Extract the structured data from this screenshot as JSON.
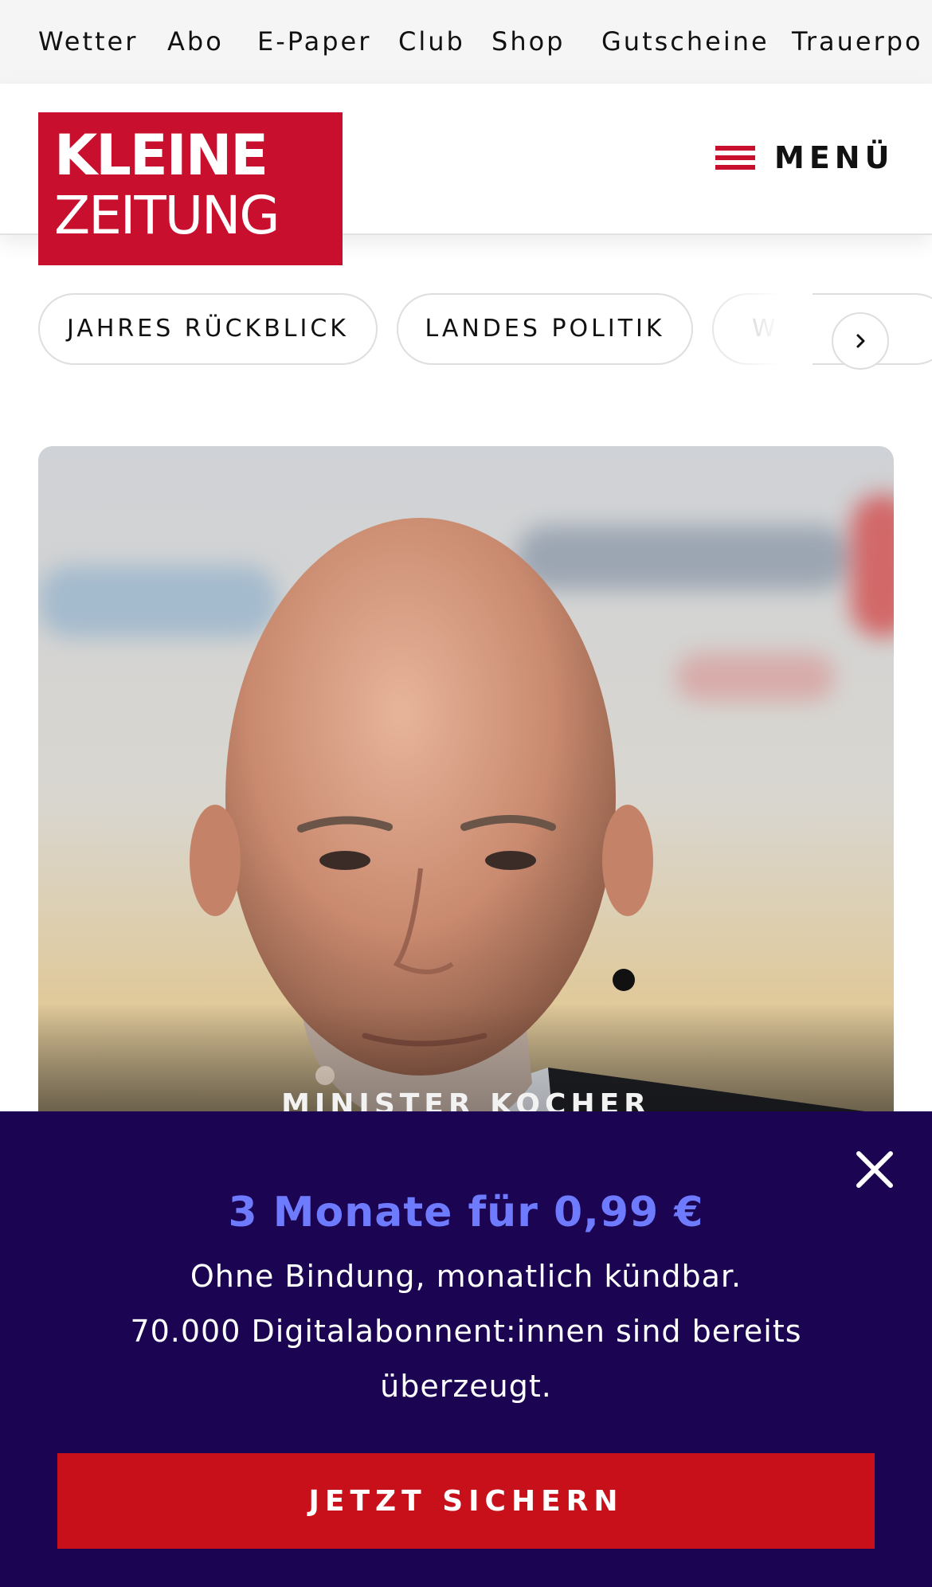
{
  "topbar": {
    "links": [
      "Wetter",
      "Abo",
      "E-Paper",
      "Club",
      "Shop",
      "Gutscheine",
      "Trauerpo"
    ]
  },
  "header": {
    "logo_line1": "KLEINE",
    "logo_line2": "ZEITUNG",
    "menu_label": "MENÜ",
    "accent_color": "#c8102e"
  },
  "chips": [
    "JAHRES RÜCKBLICK",
    "LANDES POLITIK",
    "WE"
  ],
  "hero": {
    "caption": "MINISTER KOCHER"
  },
  "promo": {
    "title": "3 Monate für 0,99 €",
    "line1": "Ohne Bindung, monatlich kündbar.",
    "line2": "70.000 Digitalabonnent:innen sind bereits",
    "line3": "überzeugt.",
    "cta": "JETZT SICHERN",
    "background_color": "#1b0552",
    "title_color": "#6f7bff",
    "cta_color": "#c8101a"
  }
}
